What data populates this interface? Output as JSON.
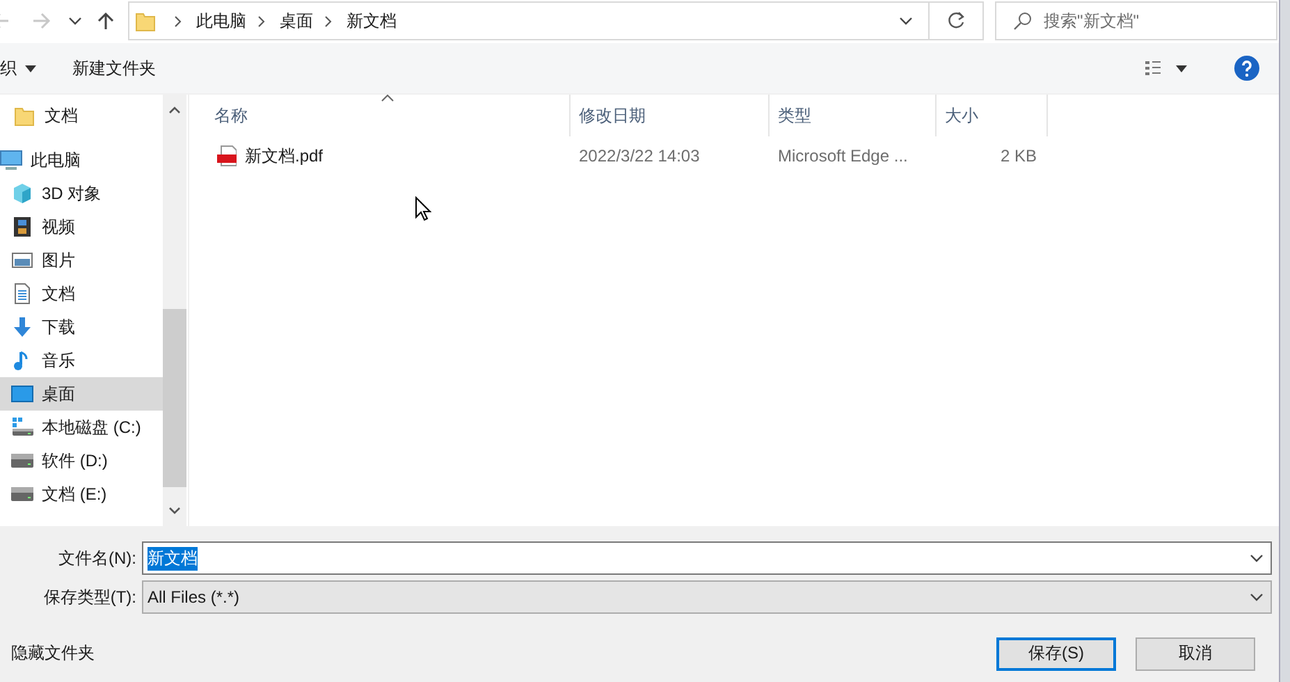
{
  "address_bar": {
    "nav_buttons": [
      {
        "kind": "back",
        "disabled": true
      },
      {
        "kind": "forward",
        "disabled": true
      },
      {
        "kind": "recent",
        "disabled": false
      },
      {
        "kind": "up",
        "disabled": false
      }
    ],
    "breadcrumbs": [
      "此电脑",
      "桌面",
      "新文档"
    ],
    "search": {
      "placeholder": "搜索\"新文档\""
    }
  },
  "toolbar": {
    "organize": "织",
    "new_folder": "新建文件夹"
  },
  "nav": {
    "items": [
      {
        "label": "文档",
        "kind": "folder",
        "selected": false
      },
      {
        "label": "此电脑",
        "kind": "pc",
        "selected": false,
        "children": [
          {
            "label": "3D 对象",
            "kind": "cube",
            "selected": false
          },
          {
            "label": "视频",
            "kind": "film",
            "selected": false
          },
          {
            "label": "图片",
            "kind": "image",
            "selected": false
          },
          {
            "label": "文档",
            "kind": "doc",
            "selected": false
          },
          {
            "label": "下载",
            "kind": "download",
            "selected": false
          },
          {
            "label": "音乐",
            "kind": "music",
            "selected": false
          },
          {
            "label": "桌面",
            "kind": "desktop",
            "selected": true
          },
          {
            "label": "本地磁盘 (C:)",
            "kind": "sysdrive",
            "selected": false
          },
          {
            "label": "软件 (D:)",
            "kind": "drive",
            "selected": false
          },
          {
            "label": "文档 (E:)",
            "kind": "drive",
            "selected": false
          }
        ]
      }
    ]
  },
  "table": {
    "columns": [
      {
        "label": "名称",
        "sorted": true
      },
      {
        "label": "修改日期",
        "sorted": false
      },
      {
        "label": "类型",
        "sorted": false
      },
      {
        "label": "大小",
        "sorted": false
      }
    ],
    "rows": [
      {
        "kind": "pdf",
        "name": "新文档.pdf",
        "modified": "2022/3/22 14:03",
        "type": "Microsoft Edge ...",
        "size": "2 KB",
        "selected": false
      }
    ]
  },
  "form": {
    "filename_label": "文件名(N):",
    "filename": "新文档",
    "filename_selected": true,
    "type_label": "保存类型(T):",
    "type": "All Files (*.*)"
  },
  "footer": {
    "hide_folders": "隐藏文件夹",
    "buttons": [
      {
        "label": "保存(S)",
        "default": true
      },
      {
        "label": "取消",
        "default": false
      }
    ]
  }
}
